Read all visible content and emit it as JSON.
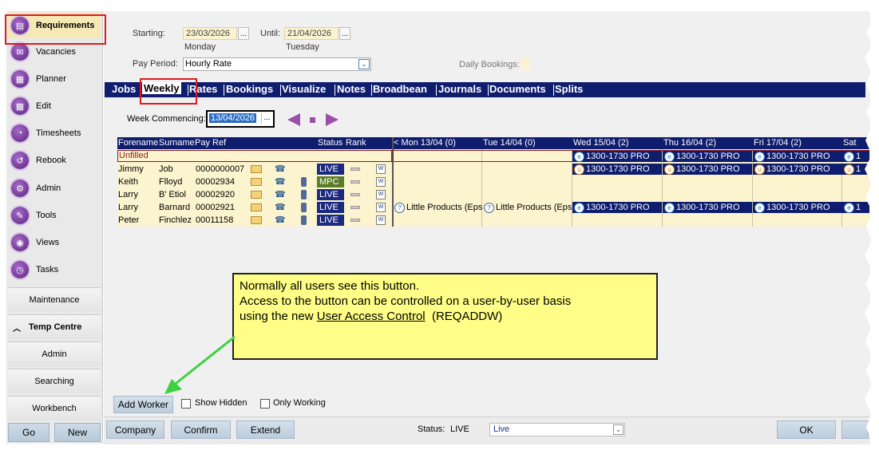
{
  "sidebar": {
    "items": [
      {
        "label": "Requirements",
        "icon": "requirements-icon",
        "glyph": "▤"
      },
      {
        "label": "Vacancies",
        "icon": "vacancies-icon",
        "glyph": "✉"
      },
      {
        "label": "Planner",
        "icon": "planner-icon",
        "glyph": "▦"
      },
      {
        "label": "Edit",
        "icon": "edit-icon",
        "glyph": "▦"
      },
      {
        "label": "Timesheets",
        "icon": "timesheets-icon",
        "glyph": "◔"
      },
      {
        "label": "Rebook",
        "icon": "rebook-icon",
        "glyph": "↺"
      },
      {
        "label": "Admin",
        "icon": "admin-icon",
        "glyph": "⚙"
      },
      {
        "label": "Tools",
        "icon": "tools-icon",
        "glyph": "✎"
      },
      {
        "label": "Views",
        "icon": "views-icon",
        "glyph": "◉"
      },
      {
        "label": "Tasks",
        "icon": "tasks-icon",
        "glyph": "◷"
      }
    ],
    "maintenance": "Maintenance",
    "temp_centre": "Temp Centre",
    "admin2": "Admin",
    "searching": "Searching",
    "workbench": "Workbench",
    "go": "Go",
    "new": "New"
  },
  "header": {
    "starting_label": "Starting:",
    "starting_value": "23/03/2026",
    "starting_day": "Monday",
    "until_label": "Until:",
    "until_value": "21/04/2026",
    "until_day": "Tuesday",
    "pay_period_label": "Pay Period:",
    "pay_period_value": "Hourly Rate",
    "daily_bookings_label": "Daily Bookings:",
    "dots": "..."
  },
  "tabs": [
    "Jobs",
    "Weekly",
    "Rates",
    "Bookings",
    "Visualize",
    "Notes",
    "Broadbean",
    "Journals",
    "Documents",
    "Splits"
  ],
  "week": {
    "label": "Week Commencing:",
    "value": "13/04/2026",
    "dots": "..."
  },
  "grid": {
    "columns": {
      "forename": "Forename",
      "surname": "Surname",
      "payref": "Pay Ref",
      "status": "Status",
      "rank": "Rank"
    },
    "days": [
      "< Mon 13/04 (0)",
      "Tue 14/04 (0)",
      "Wed 15/04 (2)",
      "Thu 16/04 (2)",
      "Fri 17/04 (2)",
      "Sat"
    ],
    "unfilled_label": "Unfilled",
    "shift": "1300-1730 PRO",
    "product": "Little Products (Epso",
    "rows": [
      {
        "forename": "Jimmy",
        "surname": "Job",
        "payref": "0000000007",
        "status": "LIVE"
      },
      {
        "forename": "Keith",
        "surname": "Flloyd",
        "payref": "00002934",
        "status": "MPC"
      },
      {
        "forename": "Larry",
        "surname": "B' Etiol",
        "payref": "00002920",
        "status": "LIVE"
      },
      {
        "forename": "Larry",
        "surname": "Barnard",
        "payref": "00002921",
        "status": "LIVE"
      },
      {
        "forename": "Peter",
        "surname": "Finchlez",
        "payref": "00011158",
        "status": "LIVE"
      }
    ],
    "sat_fragment": "1"
  },
  "callout": {
    "line1": "Normally all users see this button.",
    "line2": "Access to the button can be controlled on a user-by-user basis",
    "line3_prefix": "using the new ",
    "line3_link": "User Access Control",
    "line3_suffix": "  (REQADDW)"
  },
  "actions": {
    "add_worker": "Add Worker",
    "show_hidden": "Show Hidden",
    "only_working": "Only Working",
    "company": "Company",
    "confirm": "Confirm",
    "extend": "Extend",
    "status_label": "Status:",
    "status_code": "LIVE",
    "status_value": "Live",
    "ok": "OK"
  },
  "colors": {
    "navy": "#0f1d6e",
    "highlight_red": "#e01b1b",
    "callout_yellow": "#ffff88",
    "arrow_green": "#3fd13f",
    "nav_purple": "#7a3fa0"
  }
}
